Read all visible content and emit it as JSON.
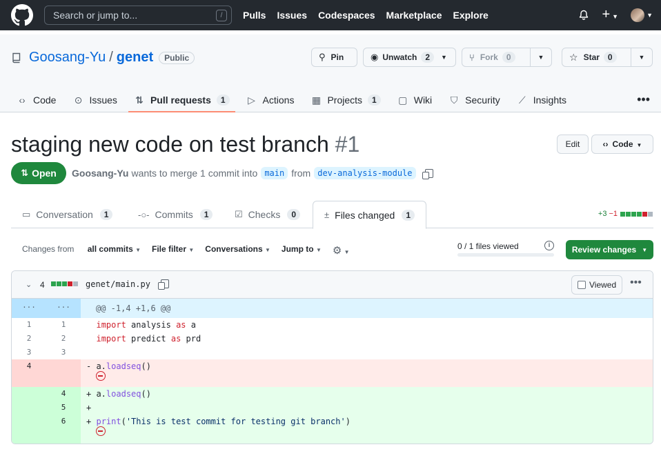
{
  "header": {
    "search_placeholder": "Search or jump to...",
    "search_key": "/",
    "nav": [
      "Pulls",
      "Issues",
      "Codespaces",
      "Marketplace",
      "Explore"
    ]
  },
  "repo": {
    "owner": "Goosang-Yu",
    "separator": "/",
    "name": "genet",
    "visibility": "Public",
    "pin_label": "Pin",
    "unwatch_label": "Unwatch",
    "unwatch_count": "2",
    "fork_label": "Fork",
    "fork_count": "0",
    "star_label": "Star",
    "star_count": "0",
    "tabs": [
      {
        "label": "Code",
        "count": "",
        "icon": "code-icon"
      },
      {
        "label": "Issues",
        "count": "",
        "icon": "issue-icon"
      },
      {
        "label": "Pull requests",
        "count": "1",
        "icon": "pull-request-icon"
      },
      {
        "label": "Actions",
        "count": "",
        "icon": "play-icon"
      },
      {
        "label": "Projects",
        "count": "1",
        "icon": "table-icon"
      },
      {
        "label": "Wiki",
        "count": "",
        "icon": "book-icon"
      },
      {
        "label": "Security",
        "count": "",
        "icon": "shield-icon"
      },
      {
        "label": "Insights",
        "count": "",
        "icon": "graph-icon"
      }
    ]
  },
  "pr": {
    "title": "staging new code on test branch",
    "number": "#1",
    "edit_label": "Edit",
    "code_label": "Code",
    "state": "Open",
    "author": "Goosang-Yu",
    "meta_text": "wants to merge 1 commit into",
    "base_branch": "main",
    "from_text": "from",
    "head_branch": "dev-analysis-module",
    "tabs": [
      {
        "label": "Conversation",
        "count": "1"
      },
      {
        "label": "Commits",
        "count": "1"
      },
      {
        "label": "Checks",
        "count": "0"
      },
      {
        "label": "Files changed",
        "count": "1"
      }
    ],
    "additions": "+3",
    "deletions": "−1"
  },
  "toolbar": {
    "changes_prefix": "Changes from",
    "changes_value": "all commits",
    "file_filter": "File filter",
    "conversations": "Conversations",
    "jump_to": "Jump to",
    "files_viewed": "0 / 1 files viewed",
    "viewed_fraction": 0,
    "review_button": "Review changes"
  },
  "file": {
    "change_count": "4",
    "path": "genet/main.py",
    "viewed_label": "Viewed",
    "hunk_left": "...",
    "hunk_right": "...",
    "hunk_header": "@@ -1,4 +1,6 @@",
    "lines": [
      {
        "type": "ctx",
        "old": "1",
        "new": "1",
        "marker": " ",
        "text": "import analysis as a"
      },
      {
        "type": "ctx",
        "old": "2",
        "new": "2",
        "marker": " ",
        "text": "import predict as prd"
      },
      {
        "type": "ctx",
        "old": "3",
        "new": "3",
        "marker": " ",
        "text": ""
      },
      {
        "type": "del",
        "old": "4",
        "new": "",
        "marker": "-",
        "text": "a.loadseq()"
      },
      {
        "type": "add",
        "old": "",
        "new": "4",
        "marker": "+",
        "text": "a.loadseq()"
      },
      {
        "type": "add",
        "old": "",
        "new": "5",
        "marker": "+",
        "text": ""
      },
      {
        "type": "add",
        "old": "",
        "new": "6",
        "marker": "+",
        "text": "print('This is test commit for testing git branch')"
      }
    ]
  },
  "colors": {
    "header_bg": "#24292f",
    "open_green": "#1f883d",
    "tab_underline": "#fd8c73",
    "del_bg": "#ffebe9",
    "add_bg": "#e6ffec"
  }
}
